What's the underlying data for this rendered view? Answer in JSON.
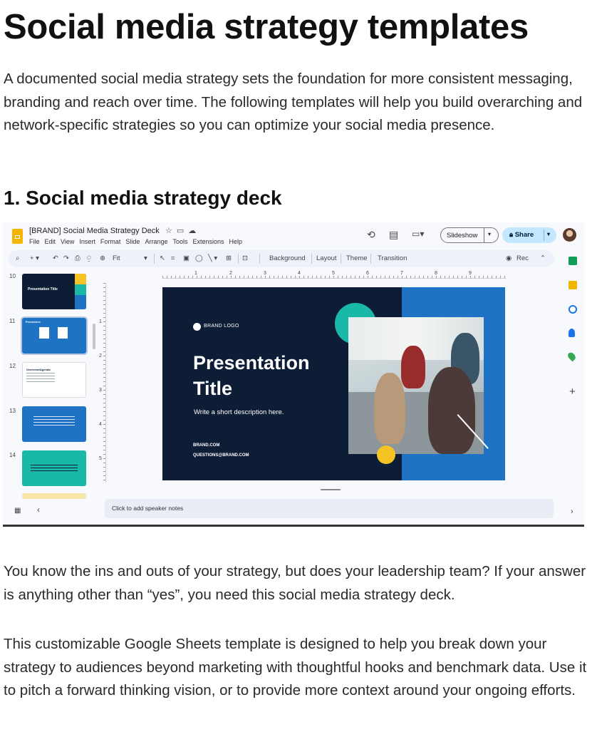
{
  "page": {
    "heading": "Social media strategy templates",
    "intro": "A documented social media strategy sets the foundation for more consistent messaging, branding and reach over time. The following templates will help you build overarching and network-specific strategies so you can optimize your social media presence.",
    "section_heading": "1. Social media strategy deck",
    "para1": "You know the ins and outs of your strategy, but does your leadership team? If your answer is anything other than “yes”, you need this social media strategy deck.",
    "para2": "This customizable Google Sheets template is designed to help you break down your strategy to audiences beyond marketing with thoughtful hooks and benchmark data. Use it to pitch a forward thinking vision, or to provide more context around your ongoing efforts."
  },
  "app": {
    "doc_title": "[BRAND] Social Media Strategy Deck",
    "menu": [
      "File",
      "Edit",
      "View",
      "Insert",
      "Format",
      "Slide",
      "Arrange",
      "Tools",
      "Extensions",
      "Help"
    ],
    "slideshow_label": "Slideshow",
    "share_label": "Share",
    "toolbar": {
      "zoom": "Fit",
      "background": "Background",
      "layout": "Layout",
      "theme": "Theme",
      "transition": "Transition",
      "rec": "Rec"
    },
    "slide_numbers": [
      "10",
      "11",
      "12",
      "13",
      "14"
    ],
    "ruler_x": [
      "1",
      "2",
      "3",
      "4",
      "5",
      "6",
      "7",
      "8",
      "9"
    ],
    "ruler_y": [
      "1",
      "2",
      "3",
      "4",
      "5"
    ],
    "notes_placeholder": "Click to add speaker notes"
  },
  "slide": {
    "brand_logo": "BRAND LOGO",
    "title": "Presentation Title",
    "description": "Write a short description here.",
    "link1": "BRAND.COM",
    "link2": "QUESTIONS@BRAND.COM"
  },
  "thumbs": {
    "t10_title": "Presentation Title",
    "t11_title": "Presenters",
    "t12_title": "Overview/Agenda"
  },
  "colors": {
    "slide_navy": "#0c1d35",
    "slide_blue": "#1f73c4",
    "slide_teal": "#19b8a8",
    "slide_yellow": "#f6c324",
    "share_bg": "#c2e7ff"
  }
}
